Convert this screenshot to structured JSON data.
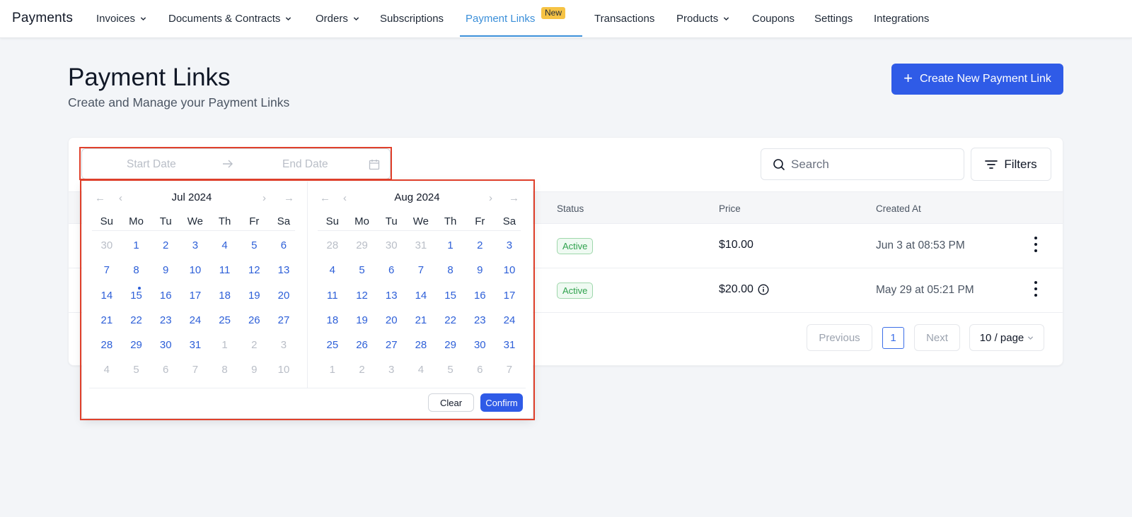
{
  "nav": {
    "brand": "Payments",
    "items": [
      {
        "label": "Invoices"
      },
      {
        "label": "Documents & Contracts"
      },
      {
        "label": "Orders"
      },
      {
        "label": "Subscriptions"
      },
      {
        "label": "Payment Links"
      },
      {
        "label": "Transactions"
      },
      {
        "label": "Products"
      },
      {
        "label": "Coupons"
      },
      {
        "label": "Settings"
      },
      {
        "label": "Integrations"
      }
    ],
    "new_badge": "New"
  },
  "header": {
    "title": "Payment Links",
    "subtitle": "Create and Manage your Payment Links",
    "create_label": "Create New Payment Link",
    "create_icon": "+"
  },
  "toolbar": {
    "start_placeholder": "Start Date",
    "end_placeholder": "End Date",
    "search_placeholder": "Search",
    "filters_label": "Filters"
  },
  "table": {
    "columns": [
      "Status",
      "Price",
      "Created At"
    ],
    "rows": [
      {
        "status": "Active",
        "price": "$10.00",
        "created": "Jun 3 at 08:53 PM"
      },
      {
        "status": "Active",
        "price": "$20.00",
        "created": "May 29 at 05:21 PM"
      }
    ]
  },
  "pagination": {
    "previous": "Previous",
    "page": "1",
    "next": "Next",
    "page_size": "10 / page"
  },
  "calendar": {
    "weekdays": [
      "Su",
      "Mo",
      "Tu",
      "We",
      "Th",
      "Fr",
      "Sa"
    ],
    "nav": {
      "prev_year": "←",
      "prev_month": "‹",
      "next_month": "›",
      "next_year": "→"
    },
    "months": [
      {
        "title": "Jul 2024",
        "weeks": [
          [
            "30",
            "1",
            "2",
            "3",
            "4",
            "5",
            "6"
          ],
          [
            "7",
            "8",
            "9",
            "10",
            "11",
            "12",
            "13"
          ],
          [
            "14",
            "15",
            "16",
            "17",
            "18",
            "19",
            "20"
          ],
          [
            "21",
            "22",
            "23",
            "24",
            "25",
            "26",
            "27"
          ],
          [
            "28",
            "29",
            "30",
            "31",
            "1",
            "2",
            "3"
          ],
          [
            "4",
            "5",
            "6",
            "7",
            "8",
            "9",
            "10"
          ]
        ],
        "muted": [
          [
            0,
            0
          ],
          [
            4,
            4
          ],
          [
            4,
            5
          ],
          [
            4,
            6
          ],
          [
            5,
            0
          ],
          [
            5,
            1
          ],
          [
            5,
            2
          ],
          [
            5,
            3
          ],
          [
            5,
            4
          ],
          [
            5,
            5
          ],
          [
            5,
            6
          ]
        ],
        "today": [
          2,
          1
        ]
      },
      {
        "title": "Aug 2024",
        "weeks": [
          [
            "28",
            "29",
            "30",
            "31",
            "1",
            "2",
            "3"
          ],
          [
            "4",
            "5",
            "6",
            "7",
            "8",
            "9",
            "10"
          ],
          [
            "11",
            "12",
            "13",
            "14",
            "15",
            "16",
            "17"
          ],
          [
            "18",
            "19",
            "20",
            "21",
            "22",
            "23",
            "24"
          ],
          [
            "25",
            "26",
            "27",
            "28",
            "29",
            "30",
            "31"
          ],
          [
            "1",
            "2",
            "3",
            "4",
            "5",
            "6",
            "7"
          ]
        ],
        "muted": [
          [
            0,
            0
          ],
          [
            0,
            1
          ],
          [
            0,
            2
          ],
          [
            0,
            3
          ],
          [
            5,
            0
          ],
          [
            5,
            1
          ],
          [
            5,
            2
          ],
          [
            5,
            3
          ],
          [
            5,
            4
          ],
          [
            5,
            5
          ],
          [
            5,
            6
          ]
        ],
        "today": null
      }
    ],
    "clear_label": "Clear",
    "confirm_label": "Confirm"
  },
  "colors": {
    "accent": "#2f5be7",
    "active_tab": "#3b8fd9",
    "highlight": "#e0402b",
    "status_active": "#2fa24d"
  }
}
